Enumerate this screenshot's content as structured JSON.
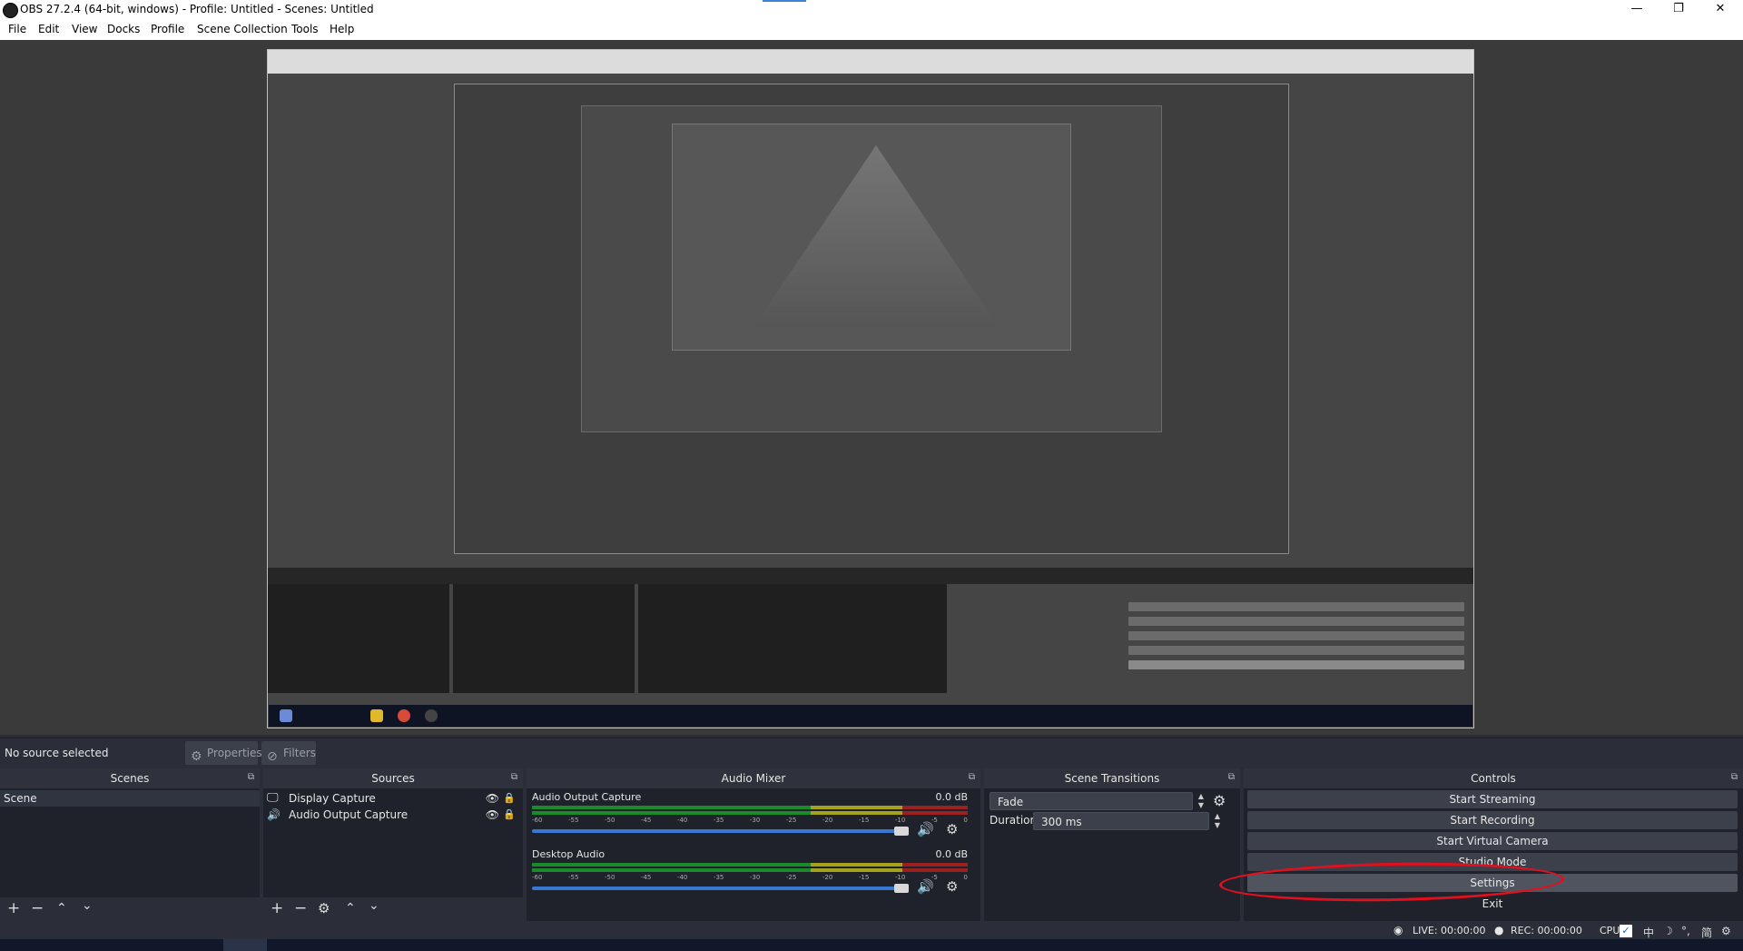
{
  "window": {
    "title": "OBS 27.2.4 (64-bit, windows) - Profile: Untitled - Scenes: Untitled",
    "controls": [
      "—",
      "❐",
      "✕"
    ]
  },
  "menu": [
    "File",
    "Edit",
    "View",
    "Docks",
    "Profile",
    "Scene Collection",
    "Tools",
    "Help"
  ],
  "status": {
    "no_source": "No source selected"
  },
  "source_tabs": {
    "properties": "Properties",
    "filters": "Filters"
  },
  "scenes": {
    "title": "Scenes",
    "items": [
      "Scene"
    ]
  },
  "sources": {
    "title": "Sources",
    "items": [
      "Display Capture",
      "Audio Output Capture"
    ]
  },
  "audio_mixer": {
    "title": "Audio Mixer",
    "channels": [
      {
        "name": "Audio Output Capture",
        "db": "0.0 dB"
      },
      {
        "name": "Desktop Audio",
        "db": "0.0 dB"
      }
    ],
    "ticks": [
      "-60",
      "-55",
      "-50",
      "-45",
      "-40",
      "-35",
      "-30",
      "-25",
      "-20",
      "-15",
      "-10",
      "-5",
      "0"
    ]
  },
  "scene_transitions": {
    "title": "Scene Transitions",
    "transition": "Fade",
    "duration_label": "Duration",
    "duration_value": "300 ms"
  },
  "controls": {
    "title": "Controls",
    "buttons": [
      "Start Streaming",
      "Start Recording",
      "Start Virtual Camera",
      "Studio Mode",
      "Settings",
      "Exit"
    ]
  },
  "stats": {
    "live": "LIVE: 00:00:00",
    "rec": "REC: 00:00:00",
    "cpu": "CPU"
  },
  "annotation_color": "#e2101e",
  "accent_color": "#3877d2"
}
